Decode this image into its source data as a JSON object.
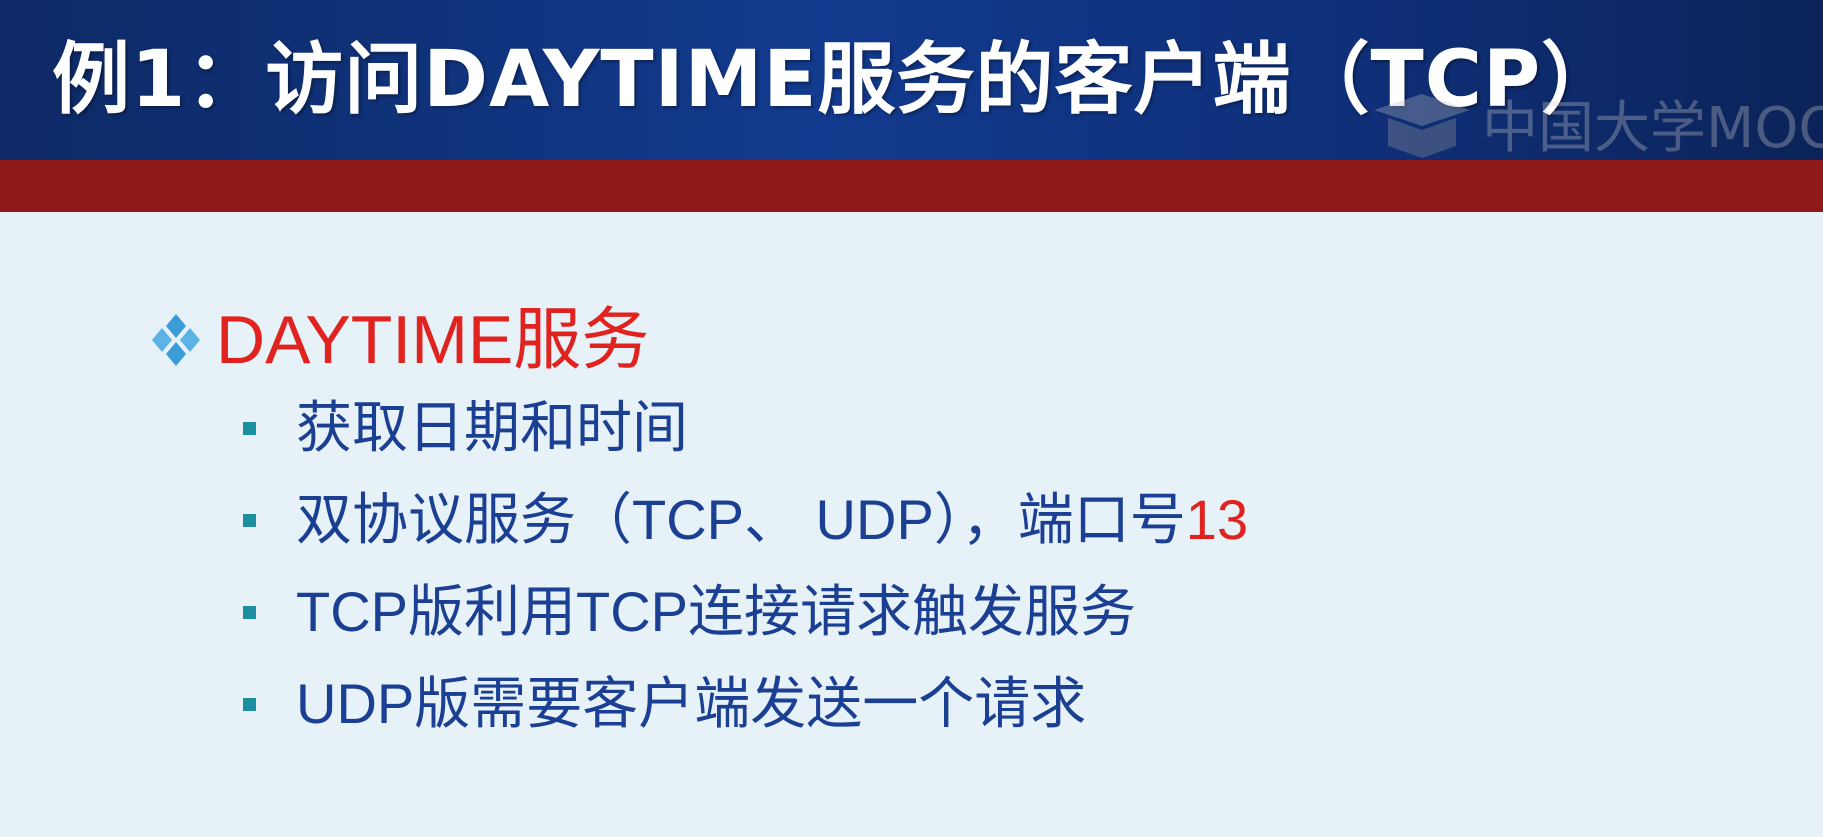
{
  "slide": {
    "title": "例1：访问DAYTIME服务的客户端（TCP）",
    "watermark": "中国大学MOOC",
    "bullet": "DAYTIME服务",
    "items": [
      {
        "text": "获取日期和时间",
        "highlight": ""
      },
      {
        "text": "双协议服务（TCP、 UDP），端口号",
        "highlight": "13"
      },
      {
        "text": "TCP版利用TCP连接请求触发服务",
        "highlight": ""
      },
      {
        "text": "UDP版需要客户端发送一个请求",
        "highlight": ""
      }
    ]
  },
  "colors": {
    "title_bar": "#123a8e",
    "red_band": "#8e1a19",
    "background": "#e6f1f8",
    "bullet_red": "#e0231f",
    "text_blue": "#1a3f93",
    "square_teal": "#1b8fa0"
  },
  "icons": {
    "main_bullet": "diamond-cluster-icon",
    "sub_bullet": "square-icon",
    "watermark_logo": "book-icon"
  }
}
